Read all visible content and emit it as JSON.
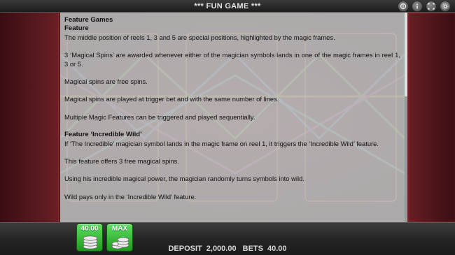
{
  "header": {
    "title": "*** FUN GAME ***",
    "icons": [
      "toggle-icon",
      "info-icon",
      "fullscreen-icon",
      "settings-icon"
    ]
  },
  "paytable": {
    "heading": "Feature Games",
    "section1_title": "Feature",
    "p1": "The middle position of reels 1, 3 and 5 are special positions, highlighted by the magic frames.",
    "p2": "3 ‘Magical Spins’ are awarded whenever either of the magician symbols lands in one of the magic frames in reel 1, 3 or 5.",
    "p3": "Magical spins are free spins.",
    "p4": "Magical spins are played at trigger bet and with the same number of lines.",
    "p5": "Multiple Magic Features can be triggered and played sequentially.",
    "section2_title": "Feature ‘Incredible Wild’",
    "p6": "If ‘The Incredible’ magician symbol lands in the magic frame on reel 1, it triggers the ‘Incredible Wild’ feature.",
    "p7": "This feature offers 3 free magical spins.",
    "p8": "Using his incredible magical power, the magician randomly turns symbols into wild.",
    "p9": "Wild pays only in the ‘Incredible Wild’ feature."
  },
  "controls": {
    "bet_value_label": "40.00",
    "max_label": "MAX"
  },
  "status": {
    "deposit_label": "DEPOSIT",
    "deposit_value": "2,000.00",
    "bets_label": "BETS",
    "bets_value": "40.00"
  },
  "colors": {
    "panel_bg": "#cdcdcd",
    "button_green": "#3cc23c",
    "frame_red": "#a33a40"
  }
}
